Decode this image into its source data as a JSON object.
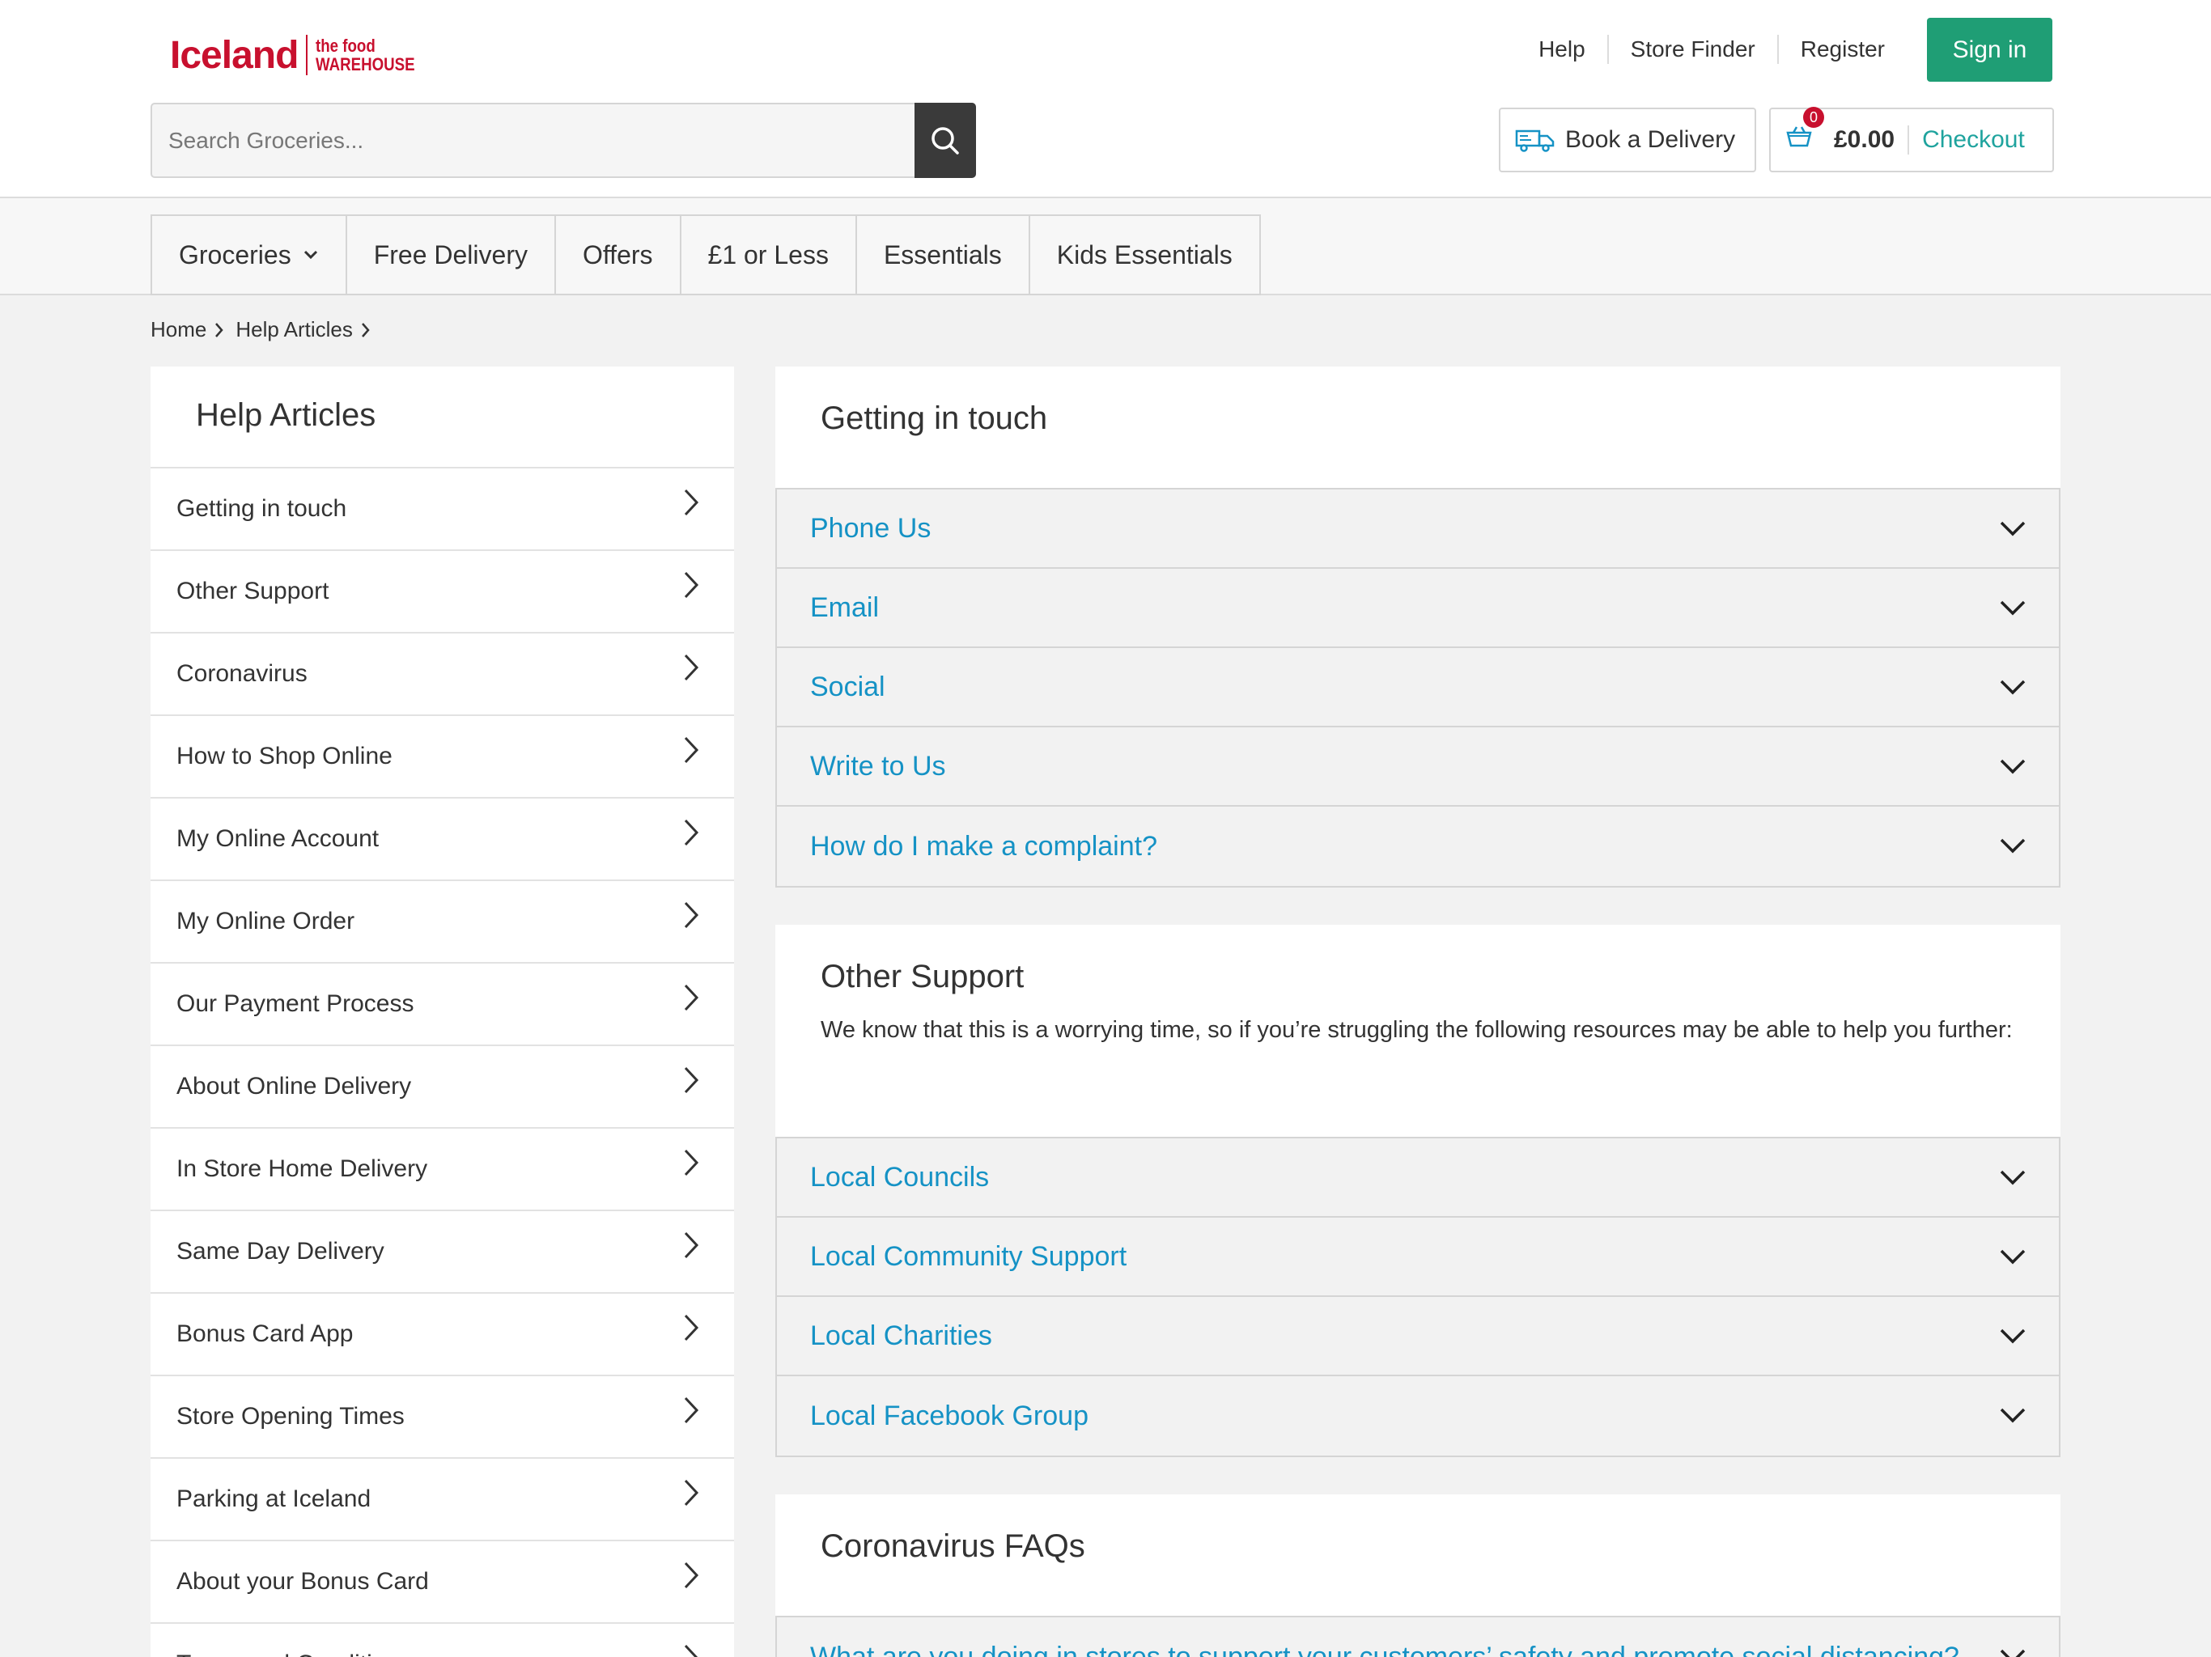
{
  "header": {
    "logo": {
      "brand": "Iceland",
      "sub_line1": "the food",
      "sub_line2": "WAREHOUSE"
    },
    "top_links": [
      "Help",
      "Store Finder",
      "Register"
    ],
    "sign_in": "Sign in",
    "search": {
      "placeholder": "Search Groceries..."
    },
    "book_delivery": "Book a Delivery",
    "basket": {
      "count": "0",
      "price": "£0.00",
      "checkout": "Checkout"
    }
  },
  "nav": {
    "tabs": [
      "Groceries",
      "Free Delivery",
      "Offers",
      "£1 or Less",
      "Essentials",
      "Kids Essentials"
    ]
  },
  "breadcrumb": [
    "Home",
    "Help Articles"
  ],
  "sidebar": {
    "title": "Help Articles",
    "items": [
      "Getting in touch",
      "Other Support",
      "Coronavirus",
      "How to Shop Online",
      "My Online Account",
      "My Online Order",
      "Our Payment Process",
      "About Online Delivery",
      "In Store Home Delivery",
      "Same Day Delivery",
      "Bonus Card App",
      "Store Opening Times",
      "Parking at Iceland",
      "About your Bonus Card",
      "Terms and Conditions"
    ]
  },
  "sections": [
    {
      "title": "Getting in touch",
      "items": [
        "Phone Us",
        "Email",
        "Social",
        "Write to Us",
        "How do I make a complaint?"
      ]
    },
    {
      "title": "Other Support",
      "description": "We know that this is a worrying time, so if you’re struggling the following resources may be able to help you further:",
      "items": [
        "Local Councils",
        "Local Community Support",
        "Local Charities",
        "Local Facebook Group"
      ]
    },
    {
      "title": "Coronavirus FAQs",
      "items": [
        "What are you doing in stores to support your customers’ safety and promote social distancing?"
      ]
    }
  ],
  "colors": {
    "brand_red": "#c8102e",
    "accent_green": "#1f9e75",
    "link_blue": "#1592c5",
    "checkout_teal": "#1fa39e"
  }
}
